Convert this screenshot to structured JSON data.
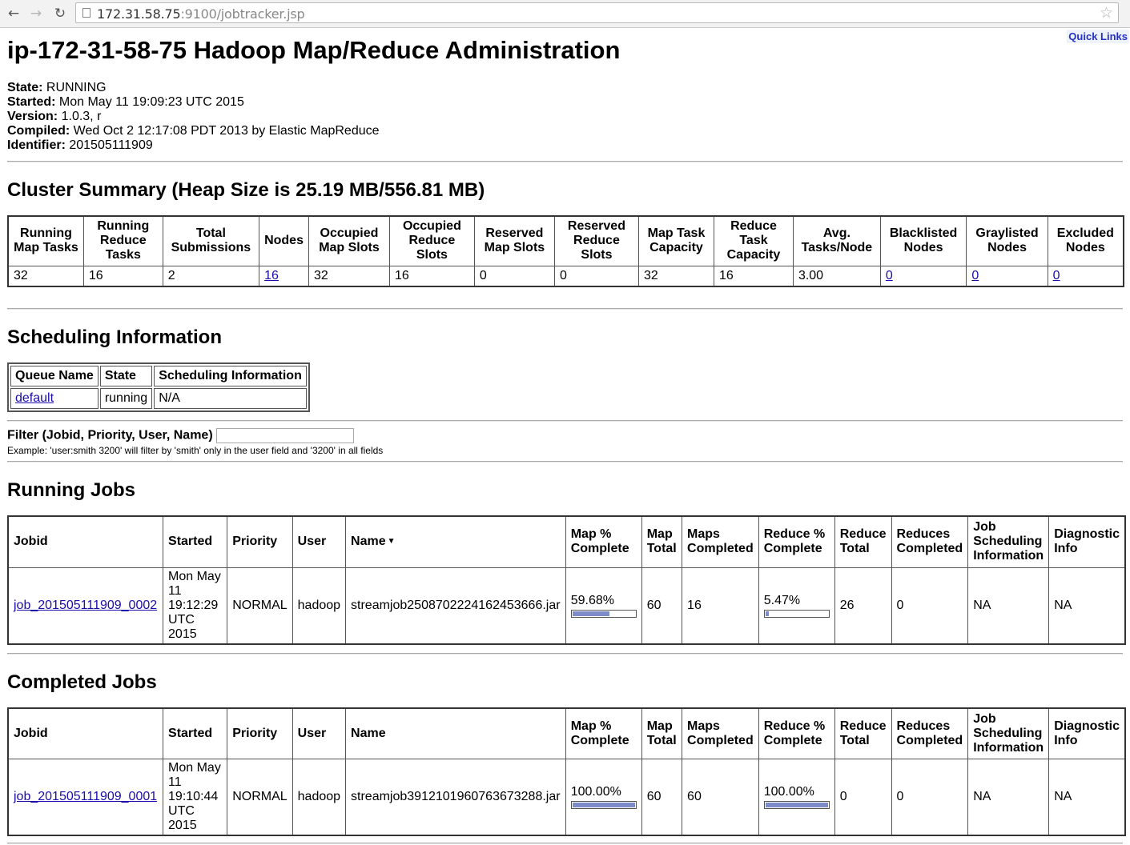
{
  "browser": {
    "url_host": "172.31.58.75",
    "url_rest": ":9100/jobtracker.jsp"
  },
  "quick_links": "Quick Links",
  "title": "ip-172-31-58-75 Hadoop Map/Reduce Administration",
  "info": {
    "state_label": "State:",
    "state": "RUNNING",
    "started_label": "Started:",
    "started": "Mon May 11 19:09:23 UTC 2015",
    "version_label": "Version:",
    "version": "1.0.3, r",
    "compiled_label": "Compiled:",
    "compiled": "Wed Oct 2 12:17:08 PDT 2013 by Elastic MapReduce",
    "identifier_label": "Identifier:",
    "identifier": "201505111909"
  },
  "cluster_summary": {
    "heading": "Cluster Summary (Heap Size is 25.19 MB/556.81 MB)",
    "headers": [
      "Running Map Tasks",
      "Running Reduce Tasks",
      "Total Submissions",
      "Nodes",
      "Occupied Map Slots",
      "Occupied Reduce Slots",
      "Reserved Map Slots",
      "Reserved Reduce Slots",
      "Map Task Capacity",
      "Reduce Task Capacity",
      "Avg. Tasks/Node",
      "Blacklisted Nodes",
      "Graylisted Nodes",
      "Excluded Nodes"
    ],
    "values": [
      "32",
      "16",
      "2",
      "16",
      "32",
      "16",
      "0",
      "0",
      "32",
      "16",
      "3.00",
      "0",
      "0",
      "0"
    ]
  },
  "scheduling": {
    "heading": "Scheduling Information",
    "headers": [
      "Queue Name",
      "State",
      "Scheduling Information"
    ],
    "row": [
      "default",
      "running",
      "N/A"
    ]
  },
  "filter": {
    "label": "Filter (Jobid, Priority, User, Name)",
    "value": "",
    "example": "Example: 'user:smith 3200' will filter by 'smith' only in the user field and '3200' in all fields"
  },
  "job_headers": [
    "Jobid",
    "Started",
    "Priority",
    "User",
    "Name",
    "Map % Complete",
    "Map Total",
    "Maps Completed",
    "Reduce % Complete",
    "Reduce Total",
    "Reduces Completed",
    "Job Scheduling Information",
    "Diagnostic Info"
  ],
  "running_jobs": {
    "heading": "Running Jobs",
    "rows": [
      {
        "jobid": "job_201505111909_0002",
        "started": "Mon May 11 19:12:29 UTC 2015",
        "priority": "NORMAL",
        "user": "hadoop",
        "name": "streamjob2508702224162453666.jar",
        "map_pct": "59.68%",
        "map_fraction": 0.5968,
        "map_total": "60",
        "maps_completed": "16",
        "reduce_pct": "5.47%",
        "reduce_fraction": 0.0547,
        "reduce_total": "26",
        "reduces_completed": "0",
        "sched_info": "NA",
        "diag_info": "NA"
      }
    ]
  },
  "completed_jobs": {
    "heading": "Completed Jobs",
    "rows": [
      {
        "jobid": "job_201505111909_0001",
        "started": "Mon May 11 19:10:44 UTC 2015",
        "priority": "NORMAL",
        "user": "hadoop",
        "name": "streamjob3912101960763673288.jar",
        "map_pct": "100.00%",
        "map_fraction": 1.0,
        "map_total": "60",
        "maps_completed": "60",
        "reduce_pct": "100.00%",
        "reduce_fraction": 1.0,
        "reduce_total": "0",
        "reduces_completed": "0",
        "sched_info": "NA",
        "diag_info": "NA"
      }
    ]
  },
  "colors": {
    "link": "#1a0dab",
    "progress_fill": "#7d8bc8",
    "quick_links": "#2530c8"
  }
}
